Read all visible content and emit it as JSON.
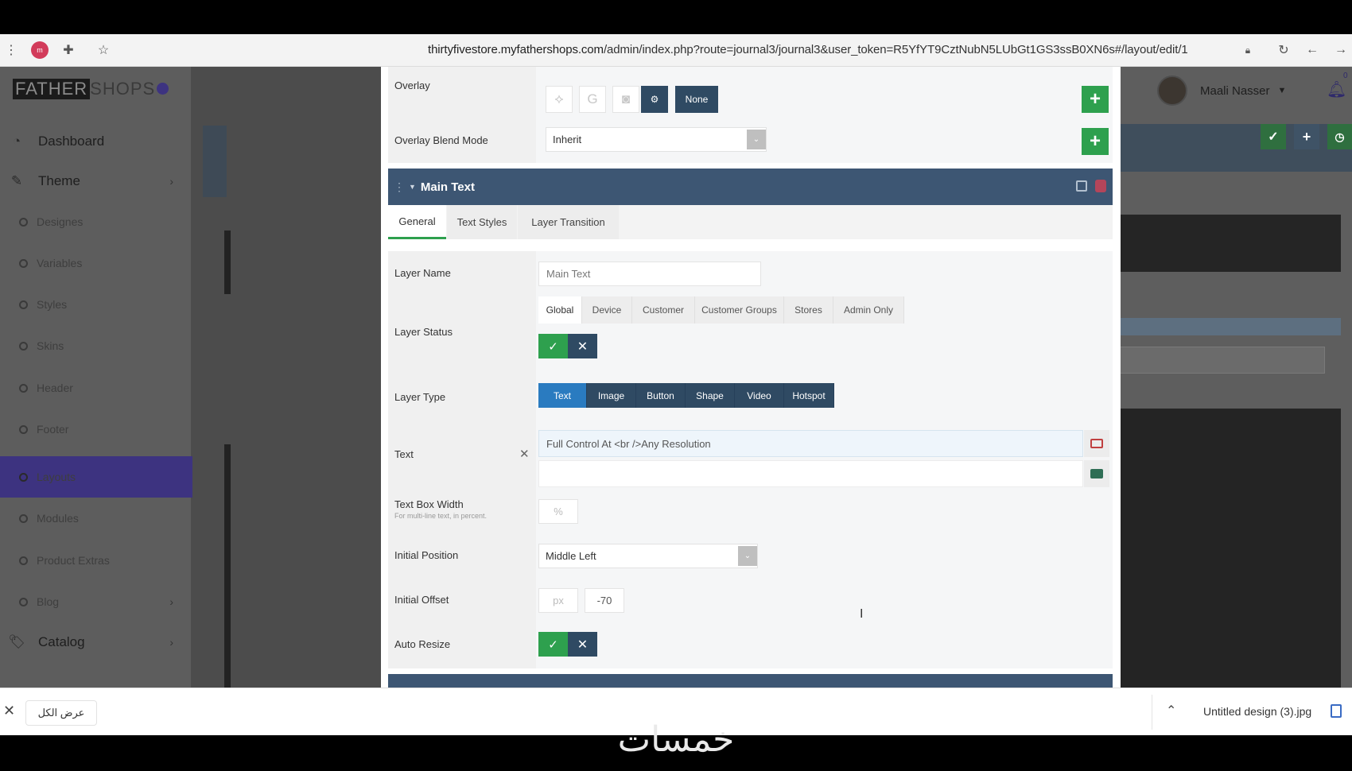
{
  "browser": {
    "profile_initial": "m",
    "url_host": "thirtyfivestore.myfathershops.com",
    "url_path": "/admin/index.php?route=journal3/journal3&user_token=R5YfYT9CztNubN5LUbGt1GS3ssB0XN6s#/layout/edit/1"
  },
  "sidebar": {
    "logo_a": "FATHER",
    "logo_b": "SHOPS",
    "items": [
      {
        "label": "Dashboard",
        "icon": "dashboard-icon",
        "type": "main"
      },
      {
        "label": "Theme",
        "icon": "brush-icon",
        "type": "main",
        "chevron": true
      },
      {
        "label": "Designes",
        "type": "sub"
      },
      {
        "label": "Variables",
        "type": "sub"
      },
      {
        "label": "Styles",
        "type": "sub"
      },
      {
        "label": "Skins",
        "type": "sub"
      },
      {
        "label": "Header",
        "type": "sub"
      },
      {
        "label": "Footer",
        "type": "sub"
      },
      {
        "label": "Layouts",
        "type": "sub",
        "active": true
      },
      {
        "label": "Modules",
        "type": "sub"
      },
      {
        "label": "Product Extras",
        "type": "sub"
      },
      {
        "label": "Blog",
        "type": "sub",
        "chevron": true
      },
      {
        "label": "Catalog",
        "icon": "tags-icon",
        "type": "main",
        "chevron": true
      }
    ]
  },
  "header": {
    "user_name": "Maali Nasser",
    "notification_count": "0"
  },
  "modal": {
    "overlay": {
      "label": "Overlay",
      "none_label": "None"
    },
    "blend": {
      "label": "Overlay Blend Mode",
      "value": "Inherit"
    },
    "section_title": "Main Text",
    "tabs": [
      "General",
      "Text Styles",
      "Layer Transition"
    ],
    "layer_name": {
      "label": "Layer Name",
      "value": "Main Text"
    },
    "layer_status": {
      "label": "Layer Status",
      "tabs": [
        "Global",
        "Device",
        "Customer",
        "Customer Groups",
        "Stores",
        "Admin Only"
      ]
    },
    "layer_type": {
      "label": "Layer Type",
      "options": [
        "Text",
        "Image",
        "Button",
        "Shape",
        "Video",
        "Hotspot"
      ],
      "selected": "Text"
    },
    "text": {
      "label": "Text",
      "value": "Full Control At <br />Any Resolution"
    },
    "text_box_width": {
      "label": "Text Box Width",
      "hint": "For multi-line text, in percent.",
      "placeholder": "%"
    },
    "initial_position": {
      "label": "Initial Position",
      "value": "Middle Left"
    },
    "initial_offset": {
      "label": "Initial Offset",
      "x_placeholder": "px",
      "y_value": "-70"
    },
    "auto_resize": {
      "label": "Auto Resize"
    }
  },
  "downloads": {
    "show_all_label": "عرض الكل",
    "file_name": "Untitled design (3).jpg"
  },
  "watermark": "خمسات"
}
